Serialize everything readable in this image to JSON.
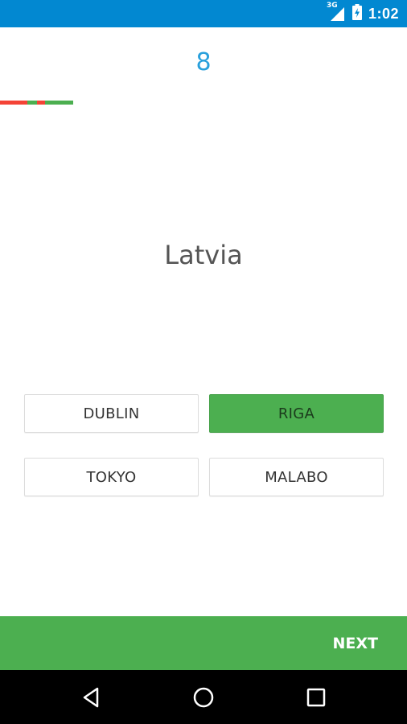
{
  "status_bar": {
    "network_type": "3G",
    "time": "1:02",
    "color": "#0288d1",
    "icons": [
      "signal-icon",
      "battery-charging-icon"
    ]
  },
  "quiz": {
    "score": "8",
    "country": "Latvia",
    "history": [
      "wrong",
      "correct",
      "wrong",
      "correct"
    ],
    "answers": [
      {
        "label": "DUBLIN",
        "state": "default"
      },
      {
        "label": "RIGA",
        "state": "correct"
      },
      {
        "label": "TOKYO",
        "state": "default"
      },
      {
        "label": "MALABO",
        "state": "default"
      }
    ],
    "colors": {
      "accent": "#29a0dc",
      "correct": "#4caf50",
      "wrong": "#f44336"
    }
  },
  "footer": {
    "next_label": "NEXT"
  },
  "navigation": {
    "icons": [
      "back-icon",
      "home-icon",
      "recents-icon"
    ]
  }
}
